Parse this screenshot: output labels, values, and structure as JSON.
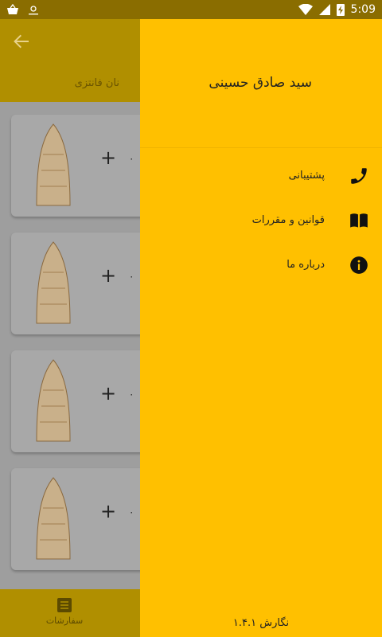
{
  "status_bar": {
    "time": "5:09"
  },
  "app_bar": {
    "back_icon": "arrow-back-icon"
  },
  "sub_bar": {
    "category": "نان فانتزی"
  },
  "products": [
    {
      "plus": "+",
      "qty": "۰"
    },
    {
      "plus": "+",
      "qty": "۰"
    },
    {
      "plus": "+",
      "qty": "۰"
    },
    {
      "plus": "+",
      "qty": "۰"
    }
  ],
  "bottom_nav": {
    "orders_label": "سفارشات"
  },
  "drawer": {
    "user_name": "سید صادق حسینی",
    "items": [
      {
        "label": "پشتیبانی",
        "icon": "phone-icon"
      },
      {
        "label": "قوانین و مقررات",
        "icon": "book-icon"
      },
      {
        "label": "درباره ما",
        "icon": "info-icon"
      }
    ],
    "version": "نگارش ۱.۴.۱"
  },
  "colors": {
    "drawer": "#ffc000",
    "scrim_bar": "#b08f00",
    "status": "#8a6d00"
  }
}
